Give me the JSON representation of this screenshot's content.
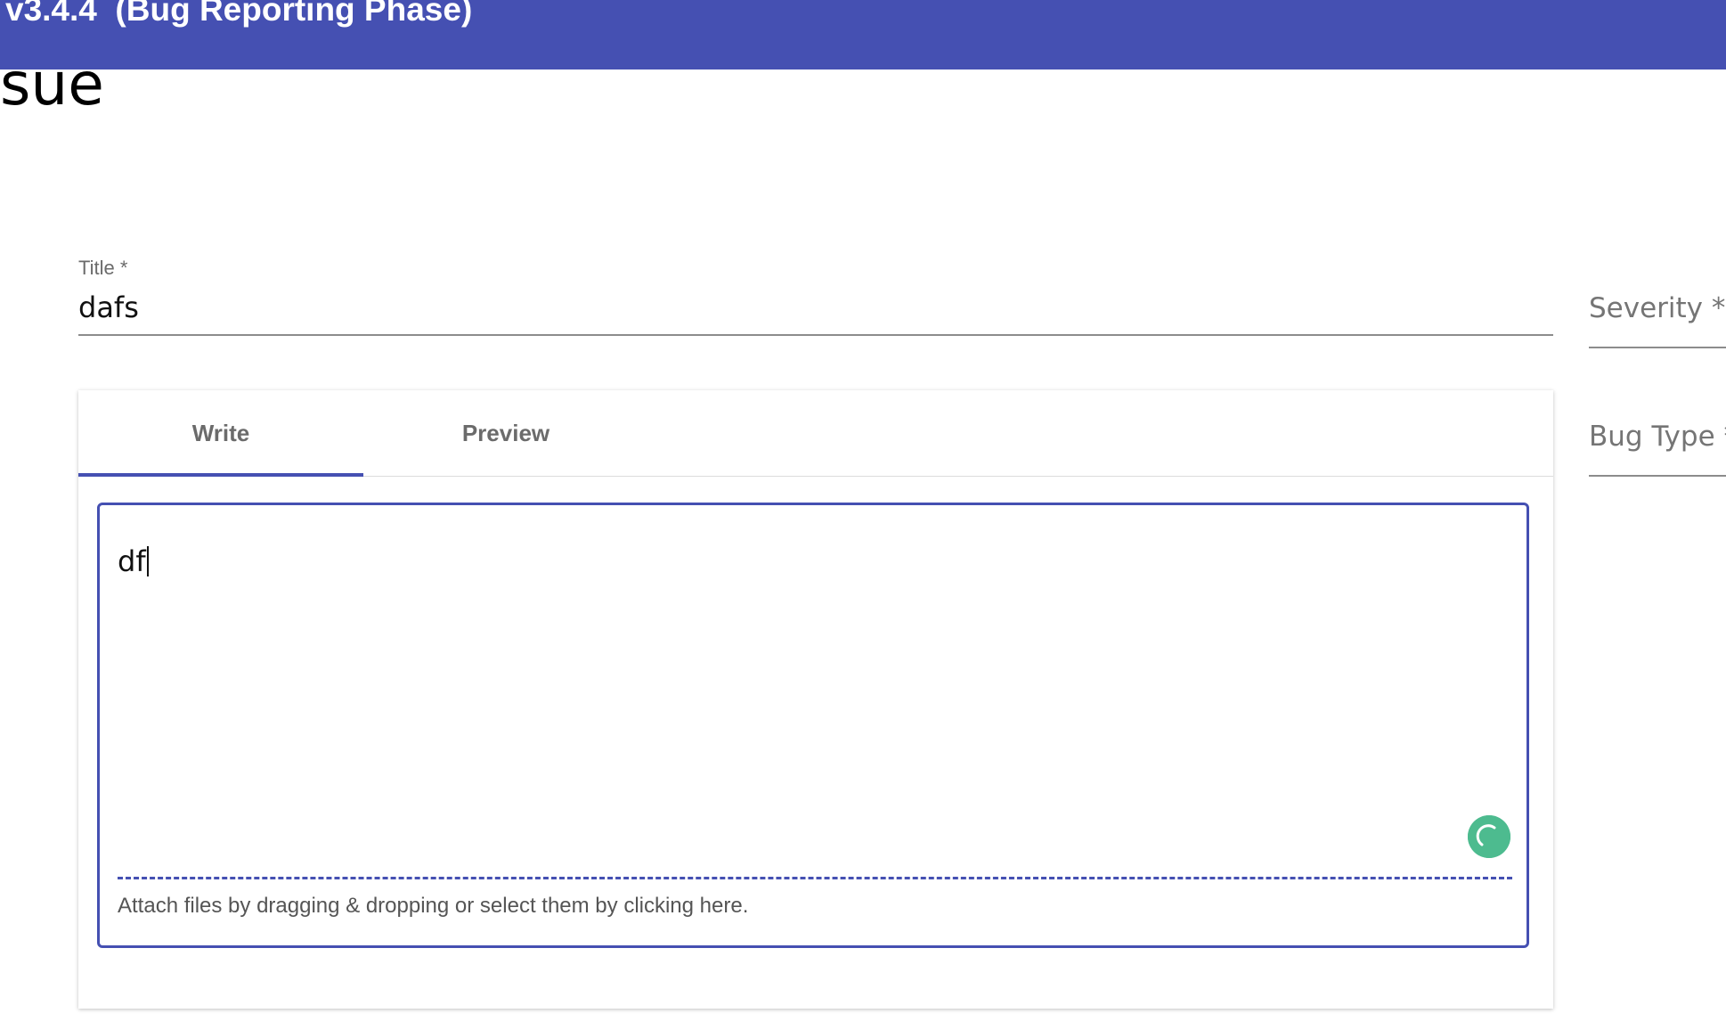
{
  "header": {
    "title": "v3.4.4  (Bug Reporting Phase)",
    "background_color": "#4550b2"
  },
  "page": {
    "heading": "sue"
  },
  "title_field": {
    "label": "Title *",
    "value": "dafs"
  },
  "side_fields": {
    "severity_label": "Severity *",
    "bug_type_label": "Bug Type *"
  },
  "editor": {
    "tabs": [
      {
        "label": "Write",
        "active": true
      },
      {
        "label": "Preview",
        "active": false
      }
    ],
    "content": "df",
    "attach_hint": "Attach files by dragging & dropping or select them by clicking here.",
    "accent_color": "#4550b2",
    "loader_color": "#4dbb8f",
    "loader_icon": "loading-spinner-icon"
  }
}
